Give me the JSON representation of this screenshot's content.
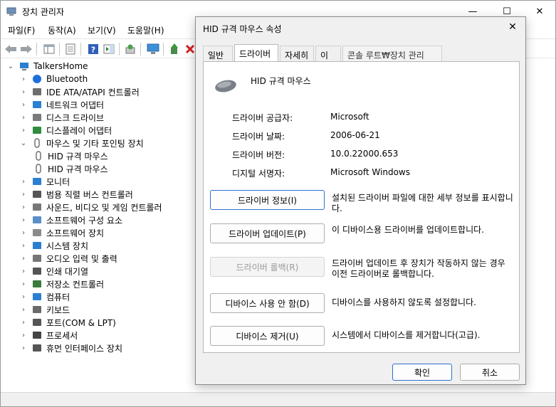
{
  "window": {
    "title": "장치 관리자",
    "minimize": "—",
    "maximize": "☐",
    "close": "✕"
  },
  "menu": [
    "파일(F)",
    "동작(A)",
    "보기(V)",
    "도움말(H)"
  ],
  "tree": {
    "root": "TalkersHome",
    "items": [
      {
        "label": "Bluetooth",
        "icon": "bluetooth-icon",
        "color": "#1e6fd9"
      },
      {
        "label": "IDE ATA/ATAPI 컨트롤러",
        "icon": "ide-controller-icon",
        "color": "#6d6d6d"
      },
      {
        "label": "네트워크 어댑터",
        "icon": "network-adapter-icon",
        "color": "#2a7fd0"
      },
      {
        "label": "디스크 드라이브",
        "icon": "disk-drive-icon",
        "color": "#7a7a7a"
      },
      {
        "label": "디스플레이 어댑터",
        "icon": "display-adapter-icon",
        "color": "#2f8c3e"
      },
      {
        "label": "마우스 및 기타 포인팅 장치",
        "icon": "mouse-icon",
        "color": "#6a6a6a",
        "expanded": true
      },
      {
        "label": "HID 규격 마우스",
        "icon": "mouse-icon",
        "color": "#6a6a6a",
        "child": true
      },
      {
        "label": "HID 규격 마우스",
        "icon": "mouse-icon",
        "color": "#6a6a6a",
        "child": true
      },
      {
        "label": "모니터",
        "icon": "monitor-icon",
        "color": "#2a7fd0"
      },
      {
        "label": "범용 직렬 버스 컨트롤러",
        "icon": "usb-icon",
        "color": "#555555"
      },
      {
        "label": "사운드, 비디오 및 게임 컨트롤러",
        "icon": "speaker-icon",
        "color": "#777777"
      },
      {
        "label": "소프트웨어 구성 요소",
        "icon": "software-component-icon",
        "color": "#5a8fc9"
      },
      {
        "label": "소프트웨어 장치",
        "icon": "software-device-icon",
        "color": "#8a8a8a"
      },
      {
        "label": "시스템 장치",
        "icon": "system-device-icon",
        "color": "#2a7fd0"
      },
      {
        "label": "오디오 입력 및 출력",
        "icon": "audio-io-icon",
        "color": "#777777"
      },
      {
        "label": "인쇄 대기열",
        "icon": "printer-icon",
        "color": "#555555"
      },
      {
        "label": "저장소 컨트롤러",
        "icon": "storage-controller-icon",
        "color": "#3a7a3a"
      },
      {
        "label": "컴퓨터",
        "icon": "computer-icon",
        "color": "#2a7fd0"
      },
      {
        "label": "키보드",
        "icon": "keyboard-icon",
        "color": "#6a6a6a"
      },
      {
        "label": "포트(COM & LPT)",
        "icon": "port-icon",
        "color": "#555555"
      },
      {
        "label": "프로세서",
        "icon": "processor-icon",
        "color": "#444444"
      },
      {
        "label": "휴먼 인터페이스 장치",
        "icon": "hid-icon",
        "color": "#555555"
      }
    ]
  },
  "dialog": {
    "title": "HID 규격 마우스 속성",
    "close": "✕",
    "tabs": [
      "일반",
      "드라이버",
      "자세히",
      "이벤트"
    ],
    "ghost_tab": "콘솔 루트₩장치 관리자...",
    "device_name": "HID 규격 마우스",
    "info": [
      {
        "label": "드라이버 공급자:",
        "value": "Microsoft"
      },
      {
        "label": "드라이버 날짜:",
        "value": "2006-06-21"
      },
      {
        "label": "드라이버 버전:",
        "value": "10.0.22000.653"
      },
      {
        "label": "디지털 서명자:",
        "value": "Microsoft Windows"
      }
    ],
    "actions": [
      {
        "button": "드라이버 정보(I)",
        "desc": "설치된 드라이버 파일에 대한 세부 정보를 표시합니다.",
        "enabled": true,
        "focused": true
      },
      {
        "button": "드라이버 업데이트(P)",
        "desc": "이 디바이스용 드라이버를 업데이트합니다.",
        "enabled": true
      },
      {
        "button": "드라이버 롤백(R)",
        "desc": "드라이버 업데이트 후 장치가 작동하지 않는 경우 이전 드라이버로 롤백합니다.",
        "enabled": false
      },
      {
        "button": "디바이스 사용 안 함(D)",
        "desc": "디바이스를 사용하지 않도록 설정합니다.",
        "enabled": true
      },
      {
        "button": "디바이스 제거(U)",
        "desc": "시스템에서 디바이스를 제거합니다(고급).",
        "enabled": true
      }
    ],
    "ok": "확인",
    "cancel": "취소"
  }
}
